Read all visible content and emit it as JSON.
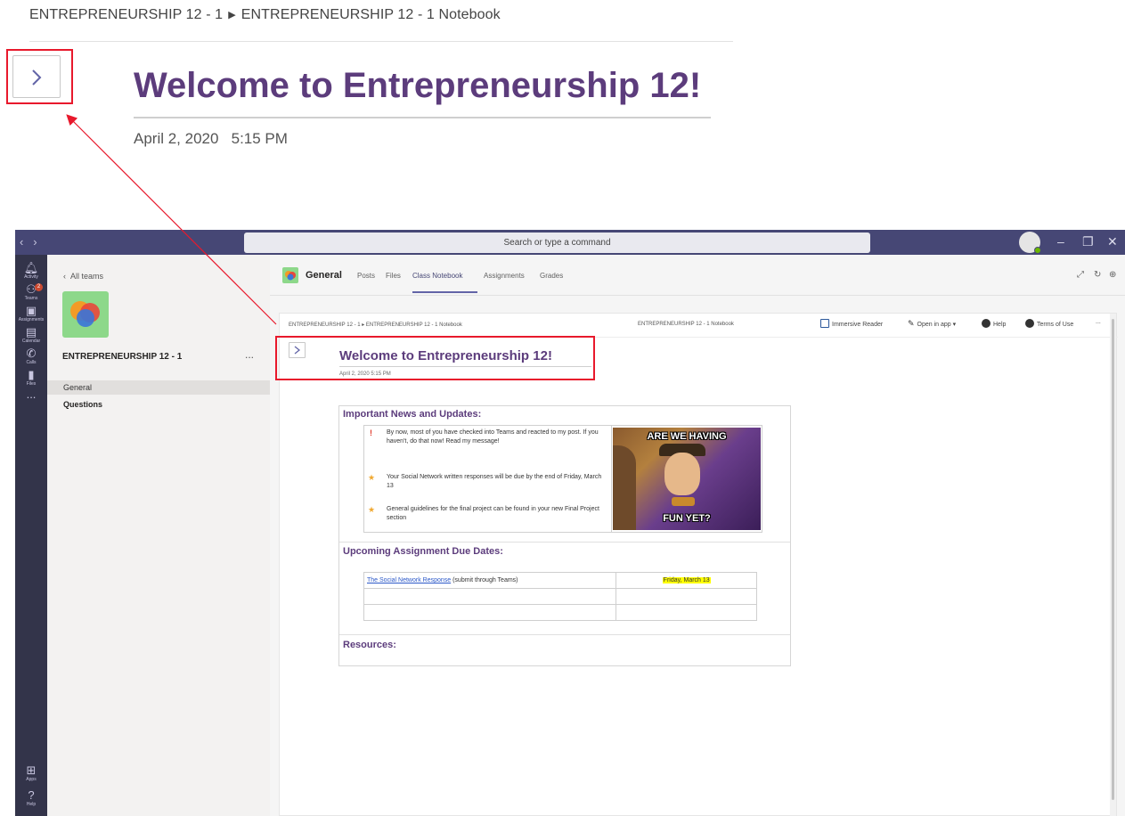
{
  "zoom": {
    "breadcrumb_part1": "ENTREPRENEURSHIP 12 - 1",
    "breadcrumb_part2": "ENTREPRENEURSHIP 12 - 1 Notebook",
    "title": "Welcome to Entrepreneurship 12!",
    "date": "April 2, 2020",
    "time": "5:15 PM"
  },
  "titlebar": {
    "search_placeholder": "Search or type a command"
  },
  "rail": {
    "items": [
      {
        "label": "Activity",
        "icon": "bell-icon"
      },
      {
        "label": "Teams",
        "icon": "teams-icon",
        "badge": "2"
      },
      {
        "label": "Assignments",
        "icon": "assignments-icon"
      },
      {
        "label": "Calendar",
        "icon": "calendar-icon"
      },
      {
        "label": "Calls",
        "icon": "phone-icon"
      },
      {
        "label": "Files",
        "icon": "file-icon"
      },
      {
        "label": "...",
        "icon": "more-icon"
      },
      {
        "label": "Apps",
        "icon": "apps-icon"
      },
      {
        "label": "Help",
        "icon": "help-icon"
      }
    ]
  },
  "teampanel": {
    "back_label": "All teams",
    "team_name": "ENTREPRENEURSHIP 12 - 1",
    "more": "...",
    "channels": [
      {
        "label": "General"
      },
      {
        "label": "Questions"
      }
    ]
  },
  "channel": {
    "name": "General",
    "tabs": [
      "Posts",
      "Files",
      "Class Notebook",
      "Assignments",
      "Grades"
    ]
  },
  "onenote": {
    "breadcrumb": "ENTREPRENEURSHIP 12 - 1 ▸ ENTREPRENEURSHIP 12 - 1 Notebook",
    "center_title": "ENTREPRENEURSHIP 12 - 1 Notebook",
    "actions": {
      "immersive": "Immersive Reader",
      "open_in_app": "Open in app",
      "help": "Help",
      "terms": "Terms of Use",
      "more": "..."
    },
    "title": "Welcome to Entrepreneurship 12!",
    "date": "April 2, 2020   5:15 PM",
    "news_heading": "Important News and Updates:",
    "bullets": [
      {
        "mark": "!",
        "text": "By now, most of you have checked into Teams and reacted to my post. If you haven't, do that now! Read my message!"
      },
      {
        "mark": "★",
        "text": "Your Social Network written responses will be due by the end of Friday, March 13"
      },
      {
        "mark": "★",
        "text": "General guidelines for the final project can be found in your new Final Project section"
      }
    ],
    "meme_top": "ARE WE HAVING",
    "meme_bottom": "FUN YET?",
    "due_heading": "Upcoming Assignment Due Dates:",
    "due_link": "The Social Network Response",
    "due_text": " (submit through Teams)",
    "due_date": "Friday, March 13",
    "resources_heading": "Resources:"
  },
  "colors": {
    "accent": "#6264a7",
    "titlebar": "#464775",
    "rail": "#33344a",
    "heading": "#5c3c7c",
    "highlight_box": "#e8192c"
  }
}
